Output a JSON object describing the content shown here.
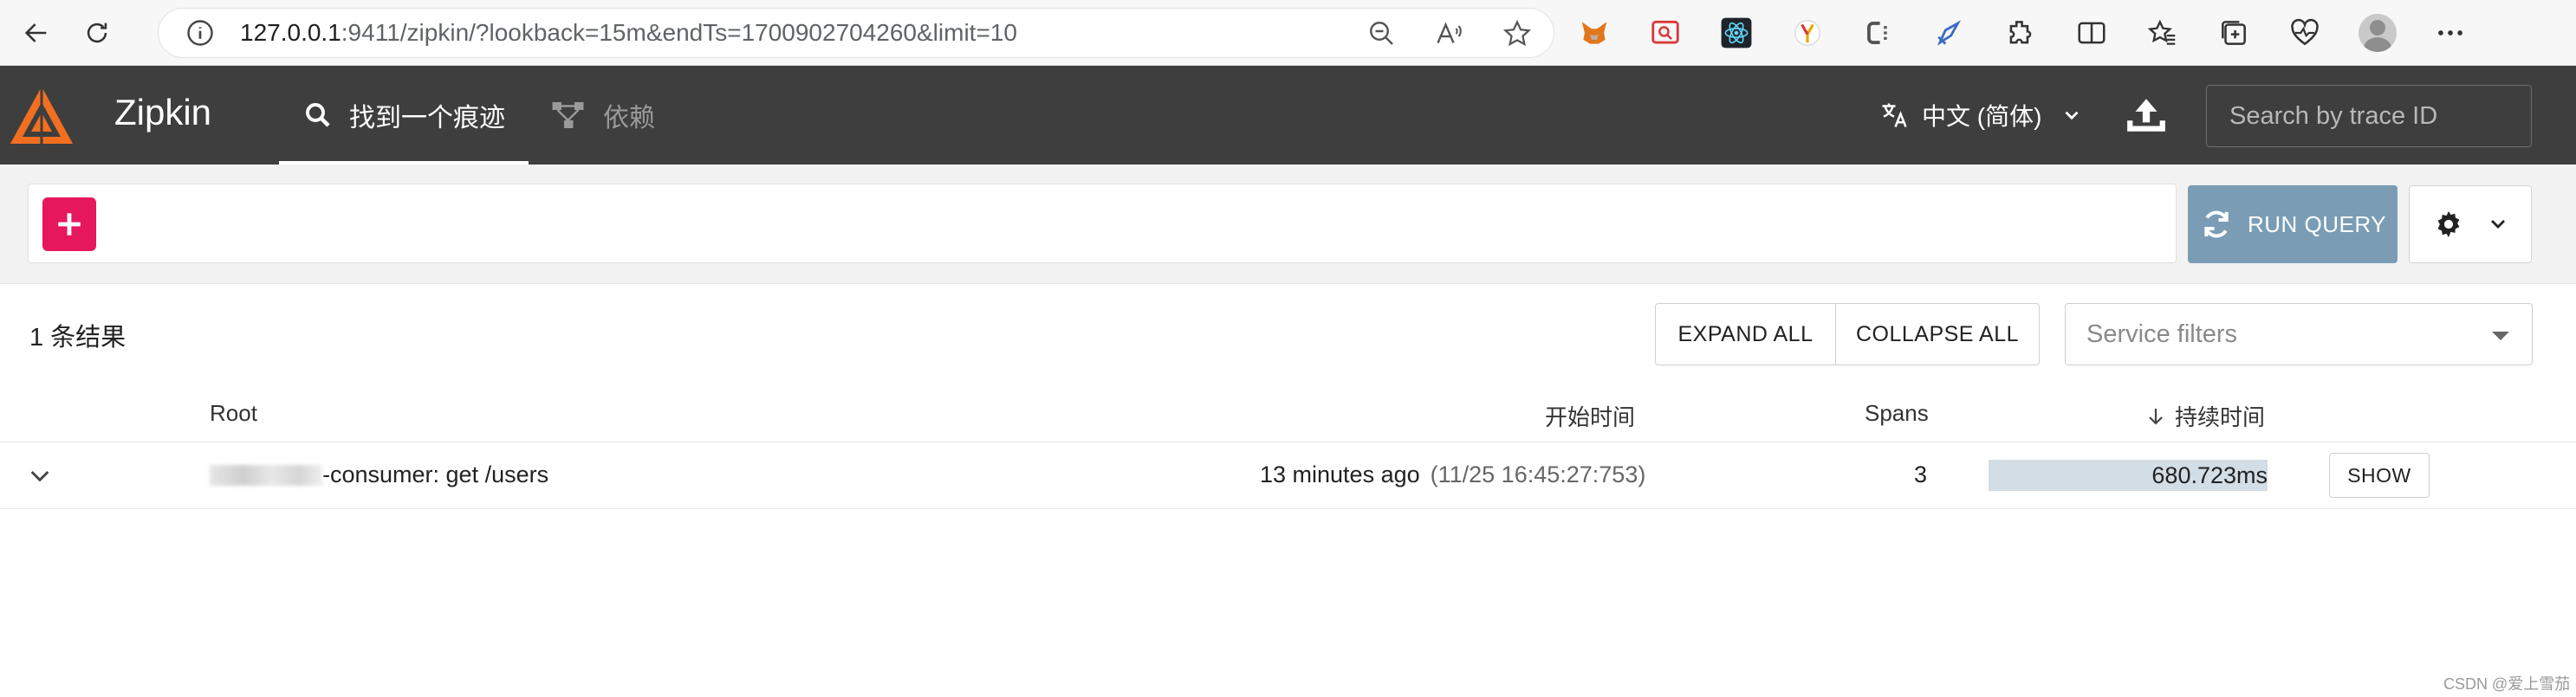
{
  "browser": {
    "url_host": "127.0.0.1",
    "url_rest": ":9411/zipkin/?lookback=15m&endTs=1700902704260&limit=10",
    "icons": [
      "back-arrow-icon",
      "refresh-icon",
      "info-icon",
      "zoom-out-icon",
      "read-aloud-icon",
      "favorite-star-icon",
      "metamask-fox-icon",
      "screen-capture-icon",
      "react-devtools-icon",
      "yandex-icon",
      "extension-c-icon",
      "rocket-icon",
      "extensions-puzzle-icon",
      "split-screen-icon",
      "favorites-icon",
      "collections-icon",
      "browser-health-icon",
      "profile-avatar-icon",
      "more-menu-icon"
    ]
  },
  "header": {
    "app_title": "Zipkin",
    "tabs": [
      {
        "label": "找到一个痕迹",
        "icon": "search-icon",
        "active": true
      },
      {
        "label": "依赖",
        "icon": "dependencies-graph-icon",
        "active": false
      }
    ],
    "language": "中文 (简体)",
    "trace_search_placeholder": "Search by trace ID"
  },
  "query": {
    "run_label": "RUN QUERY",
    "colors": {
      "add": "#e6175c",
      "run": "#7a9db5",
      "header": "#3e3e3e",
      "logo": "#f26f21"
    }
  },
  "results": {
    "count_label": "1 条结果",
    "expand_all": "EXPAND ALL",
    "collapse_all": "COLLAPSE ALL",
    "service_filter_placeholder": "Service filters",
    "columns": {
      "root": "Root",
      "start": "开始时间",
      "spans": "Spans",
      "duration": "持续时间"
    },
    "rows": [
      {
        "root": "-consumer: get /users",
        "relative_time": "13 minutes ago",
        "absolute_time": "(11/25 16:45:27:753)",
        "spans": "3",
        "duration": "680.723ms",
        "duration_fraction": 1.0,
        "show_label": "SHOW"
      }
    ]
  },
  "watermark": "CSDN @爱上雪茄"
}
